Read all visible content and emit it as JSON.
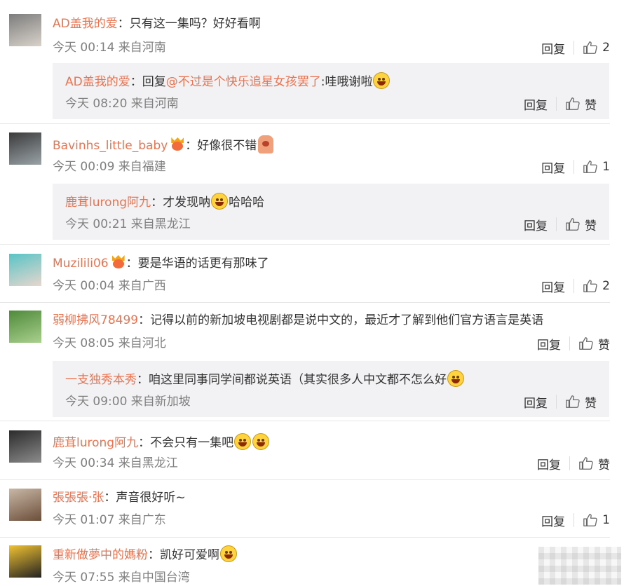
{
  "top_cut_text": "",
  "comments": [
    {
      "user": "AD盖我的爱",
      "text": "只有这一集吗？好好看啊",
      "time": "今天 00:14 来自河南",
      "reply_label": "回复",
      "like_label": "2",
      "avatar_colors": [
        "#7d7d7d",
        "#d9d2ca"
      ],
      "sub": {
        "user": "AD盖我的爱",
        "reply_prefix": "回复",
        "mention": "@不过是个快乐追星女孩罢了",
        "text": ":哇哦谢啦",
        "emoji": "laugh",
        "time": "今天 08:20 来自河南",
        "reply_label": "回复",
        "like_label": "赞"
      }
    },
    {
      "user": "Bavinhs_little_baby",
      "badge": "vip-crown",
      "text": "好像很不错",
      "sticker": "cat-sticker",
      "time": "今天 00:09 来自福建",
      "reply_label": "回复",
      "like_label": "1",
      "avatar_colors": [
        "#3a3a3a",
        "#9aa3a8"
      ],
      "sub": {
        "user": "鹿茸lurong阿九",
        "text": "才发现呐",
        "emoji": "grin",
        "text2": "哈哈哈",
        "time": "今天 00:21 来自黑龙江",
        "reply_label": "回复",
        "like_label": "赞"
      }
    },
    {
      "user": "Muzilili06",
      "badge": "vip-crown",
      "text": "要是华语的话更有那味了",
      "time": "今天 00:04 来自广西",
      "reply_label": "回复",
      "like_label": "2",
      "avatar_colors": [
        "#58c4c6",
        "#e8d6cd"
      ]
    },
    {
      "user": "弱柳拂风78499",
      "text": "记得以前的新加坡电视剧都是说中文的，最近才了解到他们官方语言是英语",
      "time": "今天 08:05 来自河北",
      "reply_label": "回复",
      "like_label": "赞",
      "avatar_colors": [
        "#4f8a3a",
        "#a9d08e"
      ],
      "sub": {
        "user": "一支独秀本秀",
        "text": "咱这里同事同学间都说英语（其实很多人中文都不怎么好",
        "emoji": "laugh",
        "time": "今天 09:00 来自新加坡",
        "reply_label": "回复",
        "like_label": "赞"
      }
    },
    {
      "user": "鹿茸lurong阿九",
      "text": "不会只有一集吧",
      "emoji": "tears",
      "emoji_count": 2,
      "time": "今天 00:34 来自黑龙江",
      "reply_label": "回复",
      "like_label": "赞",
      "avatar_colors": [
        "#2b2b2b",
        "#8c8c8c"
      ]
    },
    {
      "user": "張張張·张",
      "text": "声音很好听~",
      "time": "今天 01:07 来自广东",
      "reply_label": "回复",
      "like_label": "1",
      "avatar_colors": [
        "#c9b7a6",
        "#6b4f3a"
      ]
    },
    {
      "user": "重新做夢中的媽粉",
      "text": "凯好可爱啊",
      "emoji": "shy",
      "time": "今天 07:55 来自中国台湾",
      "avatar_colors": [
        "#f1c232",
        "#222222"
      ]
    }
  ],
  "icons": {
    "like": "thumbs-up-icon",
    "reply": "reply-link"
  },
  "colors": {
    "name": "#eb7350",
    "meta": "#808080",
    "reply_bg": "#f2f2f5",
    "divider": "#e6e6e6"
  }
}
